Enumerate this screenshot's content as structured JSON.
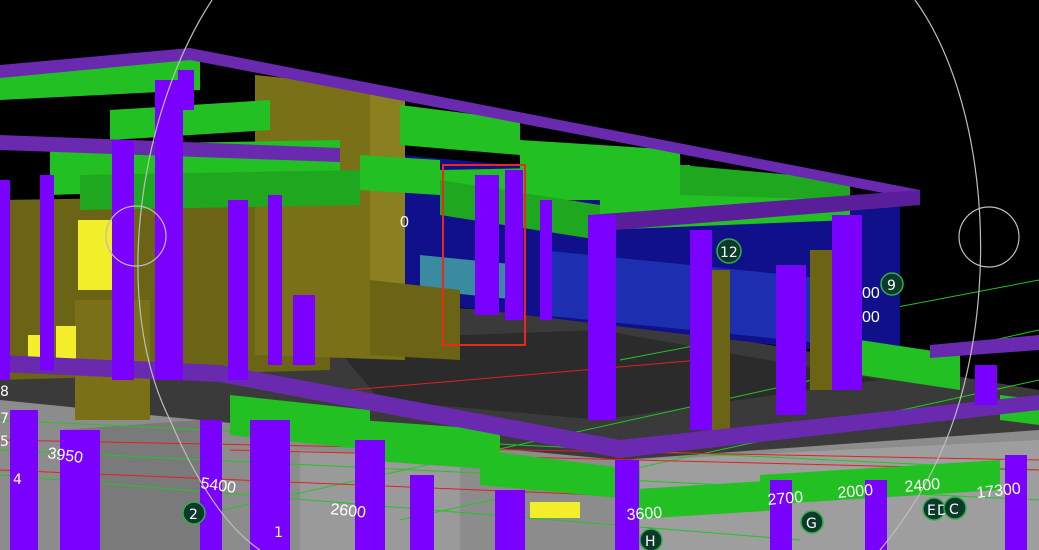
{
  "dimensions": [
    "3950",
    "5400",
    "2600",
    "3600",
    "2700",
    "2000",
    "2400",
    "17300",
    "0",
    "00"
  ],
  "axis_markers": [
    "12",
    "9",
    "8",
    "7",
    "5",
    "4",
    "2",
    "1",
    "H",
    "G",
    "E",
    "D",
    "C"
  ],
  "colors": {
    "background": "#000000",
    "column_purple": "#7a00ff",
    "beam_green": "#22c022",
    "wall_olive": "#6b6414",
    "glass_blue": "#1a1aa0",
    "floor_dark": "#333333",
    "cladding_gray": "#8c8c8c",
    "highlight_yellow": "#f2ee2a",
    "selection_red": "#e8291c",
    "grid_green": "#23c423",
    "grid_red": "#e02020"
  },
  "selection": {
    "label": ""
  }
}
